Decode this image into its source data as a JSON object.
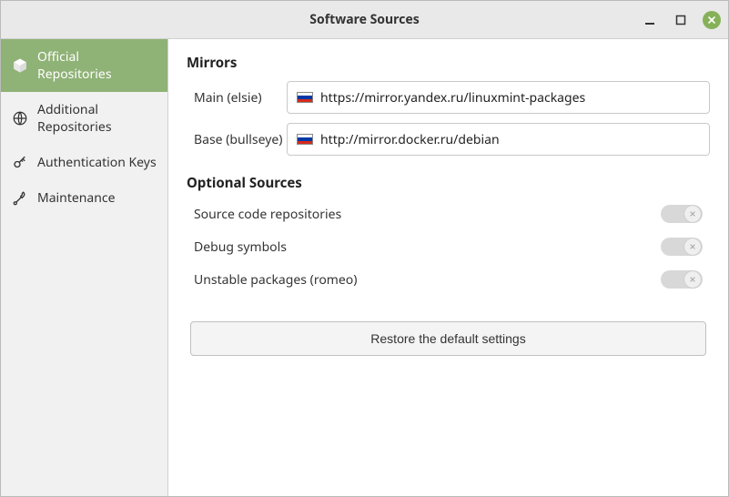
{
  "window": {
    "title": "Software Sources"
  },
  "sidebar": {
    "items": [
      {
        "label": "Official Repositories"
      },
      {
        "label": "Additional Repositories"
      },
      {
        "label": "Authentication Keys"
      },
      {
        "label": "Maintenance"
      }
    ]
  },
  "mirrors": {
    "heading": "Mirrors",
    "main_label": "Main (elsie)",
    "main_url": "https://mirror.yandex.ru/linuxmint-packages",
    "base_label": "Base (bullseye)",
    "base_url": "http://mirror.docker.ru/debian"
  },
  "optional": {
    "heading": "Optional Sources",
    "source_label": "Source code repositories",
    "source_on": false,
    "debug_label": "Debug symbols",
    "debug_on": false,
    "unstable_label": "Unstable packages (romeo)",
    "unstable_on": false
  },
  "restore": {
    "label": "Restore the default settings"
  }
}
